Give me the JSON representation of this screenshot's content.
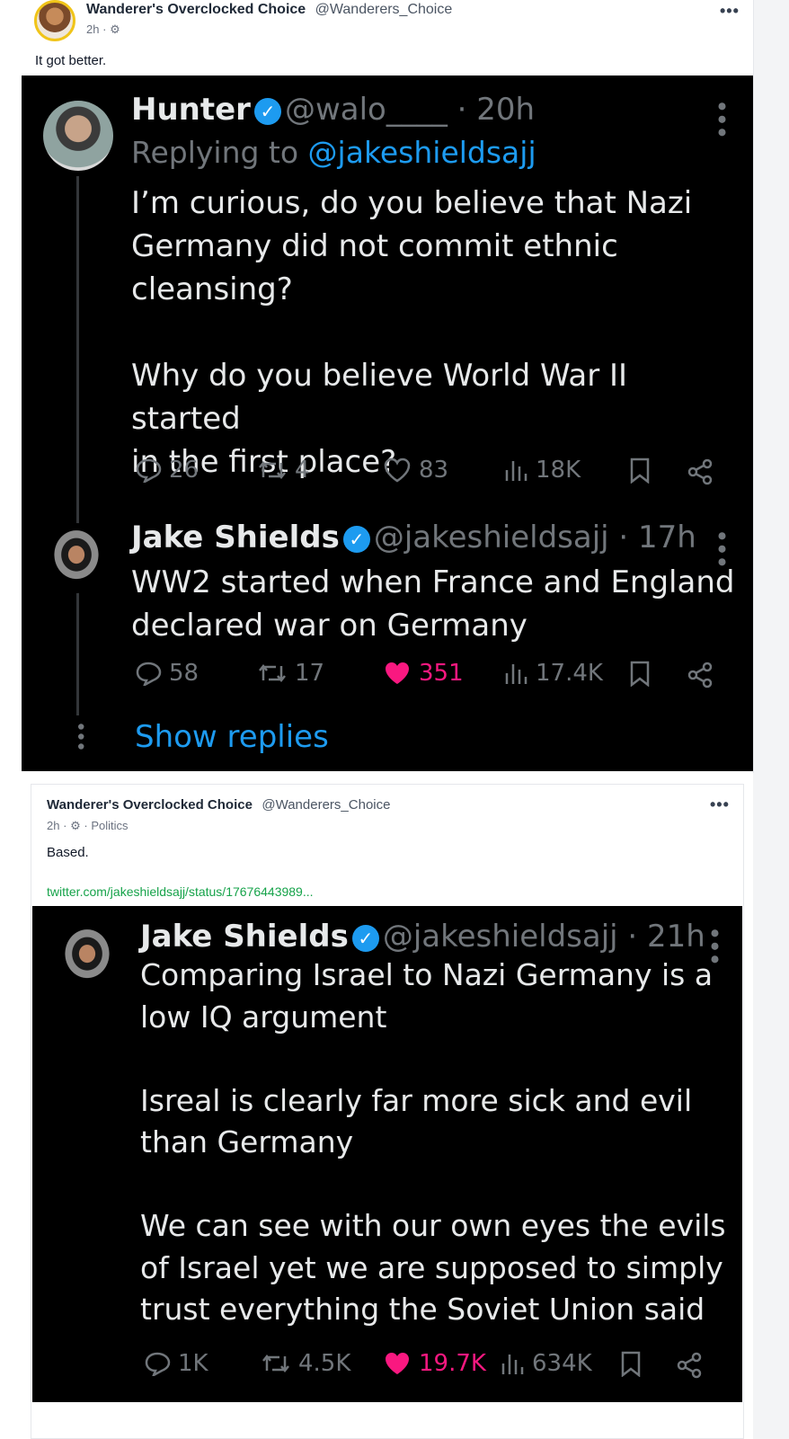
{
  "post1": {
    "author": "Wanderer's Overclocked Choice",
    "handle": "@Wanderers_Choice",
    "time": "2h",
    "sep": "·",
    "menu": "•••",
    "text": "It got better.",
    "embed": {
      "tweet1": {
        "name": "Hunter",
        "handle": "@walo____",
        "time": "· 20h",
        "replying_prefix": "Replying to",
        "replying_to": "@jakeshieldsajj",
        "body": "I’m curious, do you believe that Nazi\nGermany did not commit ethnic\ncleansing?\n\nWhy do you believe World War II started\nin the first place?",
        "replies": "26",
        "retweets": "4",
        "likes": "83",
        "views": "18K"
      },
      "tweet2": {
        "name": "Jake Shields",
        "handle": "@jakeshieldsajj",
        "time": "· 17h",
        "body": "WW2 started when France and England\ndeclared war on Germany",
        "replies": "58",
        "retweets": "17",
        "likes": "351",
        "views": "17.4K"
      },
      "show_replies": "Show replies"
    }
  },
  "post2": {
    "author": "Wanderer's Overclocked Choice",
    "handle": "@Wanderers_Choice",
    "time": "2h",
    "sep": "·",
    "category": "Politics",
    "menu": "•••",
    "text": "Based.",
    "link": "twitter.com/jakeshieldsajj/status/17676443989...",
    "embed": {
      "name": "Jake Shields",
      "handle": "@jakeshieldsajj",
      "time": "· 21h",
      "body": "Comparing Israel to Nazi Germany is a\nlow IQ argument\n\nIsreal is clearly far more sick and evil\nthan Germany\n\nWe can see with our own eyes the evils\nof Israel yet we are supposed to simply\ntrust everything the Soviet Union said",
      "replies": "1K",
      "retweets": "4.5K",
      "likes": "19.7K",
      "views": "634K"
    }
  },
  "colors": {
    "twitter_blue": "#1d9bf0",
    "like_pink": "#f91880",
    "link_green": "#16a34a",
    "tweet_bg": "#000000"
  }
}
